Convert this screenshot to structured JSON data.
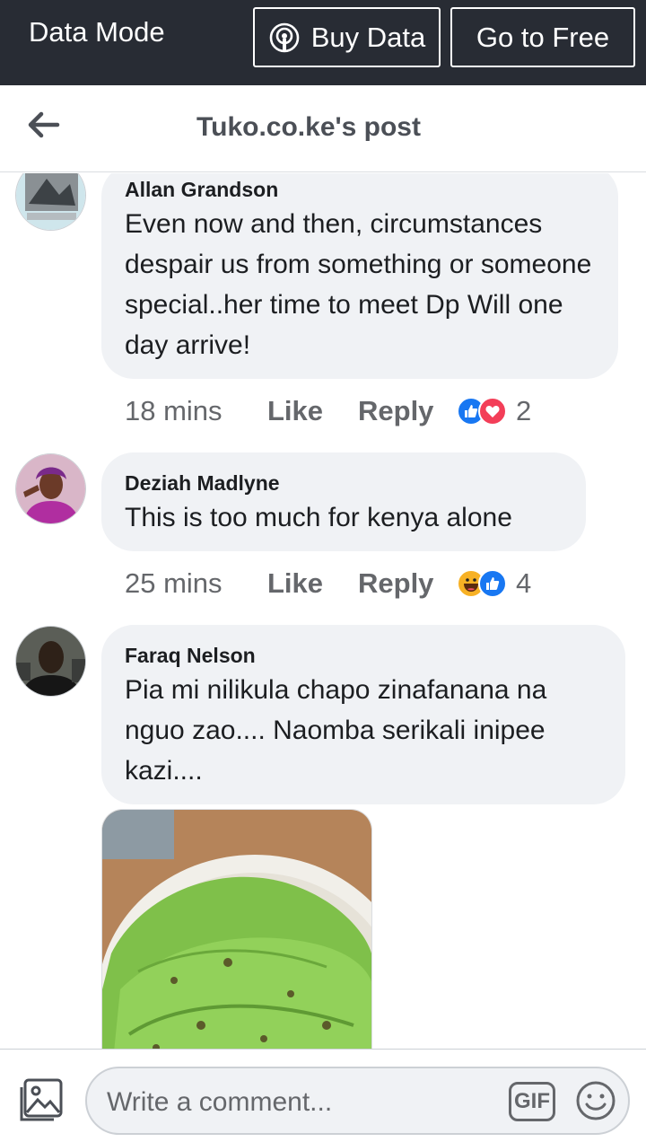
{
  "databar": {
    "mode_label": "Data Mode",
    "buy_label": "Buy Data",
    "free_label": "Go to Free"
  },
  "header": {
    "title": "Tuko.co.ke's post"
  },
  "comments": [
    {
      "name": "Allan Grandson",
      "text": "Even now and then, circumstances despair us from something or someone special..her time to meet Dp Will one day arrive!",
      "time": "18 mins",
      "like": "Like",
      "reply": "Reply",
      "reactions": [
        "like-icon",
        "love-icon"
      ],
      "reaction_count": "2"
    },
    {
      "name": "Deziah Madlyne",
      "text": "This is too much for kenya alone",
      "time": "25 mins",
      "like": "Like",
      "reply": "Reply",
      "reactions": [
        "haha-icon",
        "like-icon"
      ],
      "reaction_count": "4"
    },
    {
      "name": "Faraq Nelson",
      "text": "Pia mi nilikula chapo zinafanana na nguo zao....  Naomba serikali inipee kazi...."
    }
  ],
  "composer": {
    "placeholder": "Write a comment...",
    "gif_label": "GIF"
  },
  "colors": {
    "databar_bg": "#282c34",
    "bubble_bg": "#f0f2f5",
    "like_blue": "#1877f2",
    "love_red": "#f33e58",
    "haha_yellow": "#f7b125"
  }
}
